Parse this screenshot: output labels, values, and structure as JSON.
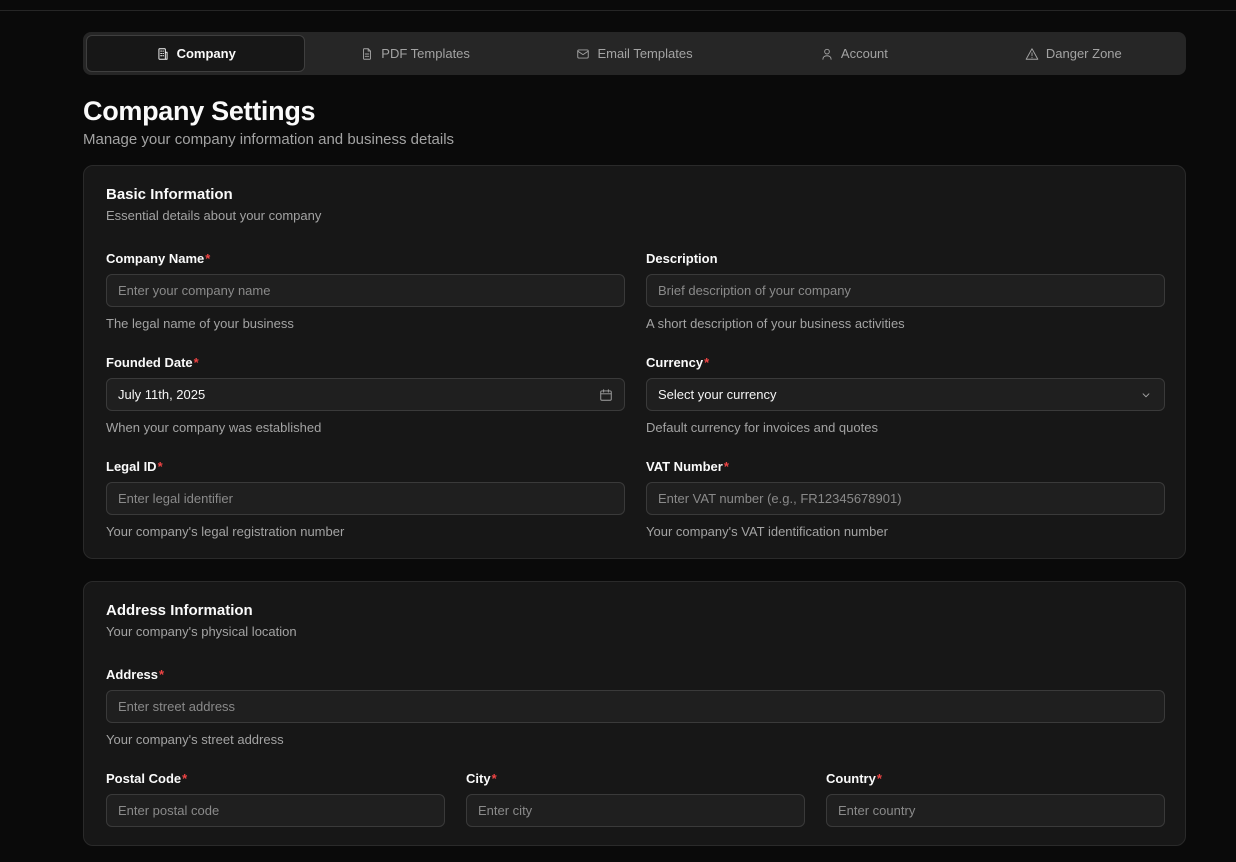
{
  "tabs": [
    {
      "label": "Company",
      "icon": "building-icon",
      "active": true
    },
    {
      "label": "PDF Templates",
      "icon": "file-text-icon"
    },
    {
      "label": "Email Templates",
      "icon": "mail-icon"
    },
    {
      "label": "Account",
      "icon": "user-icon"
    },
    {
      "label": "Danger Zone",
      "icon": "warning-triangle-icon"
    }
  ],
  "page": {
    "title": "Company Settings",
    "subtitle": "Manage your company information and business details"
  },
  "basic": {
    "title": "Basic Information",
    "subtitle": "Essential details about your company",
    "fields": {
      "company_name": {
        "label": "Company Name",
        "required": "*",
        "placeholder": "Enter your company name",
        "help": "The legal name of your business"
      },
      "description": {
        "label": "Description",
        "placeholder": "Brief description of your company",
        "help": "A short description of your business activities"
      },
      "founded_date": {
        "label": "Founded Date",
        "required": "*",
        "value": "July 11th, 2025",
        "help": "When your company was established",
        "icon": "calendar-icon"
      },
      "currency": {
        "label": "Currency",
        "required": "*",
        "value": "Select your currency",
        "help": "Default currency for invoices and quotes",
        "icon": "chevron-down-icon"
      },
      "legal_id": {
        "label": "Legal ID",
        "required": "*",
        "placeholder": "Enter legal identifier",
        "help": "Your company's legal registration number"
      },
      "vat_number": {
        "label": "VAT Number",
        "required": "*",
        "placeholder": "Enter VAT number (e.g., FR12345678901)",
        "help": "Your company's VAT identification number"
      }
    }
  },
  "address": {
    "title": "Address Information",
    "subtitle": "Your company's physical location",
    "fields": {
      "street": {
        "label": "Address",
        "required": "*",
        "placeholder": "Enter street address",
        "help": "Your company's street address"
      },
      "postal_code": {
        "label": "Postal Code",
        "required": "*",
        "placeholder": "Enter postal code"
      },
      "city": {
        "label": "City",
        "required": "*",
        "placeholder": "Enter city"
      },
      "country": {
        "label": "Country",
        "required": "*",
        "placeholder": "Enter country"
      }
    }
  },
  "colors": {
    "background": "#0a0a0a",
    "card": "#171717",
    "required": "#ef4444",
    "muted_text": "#a3a3a3"
  }
}
